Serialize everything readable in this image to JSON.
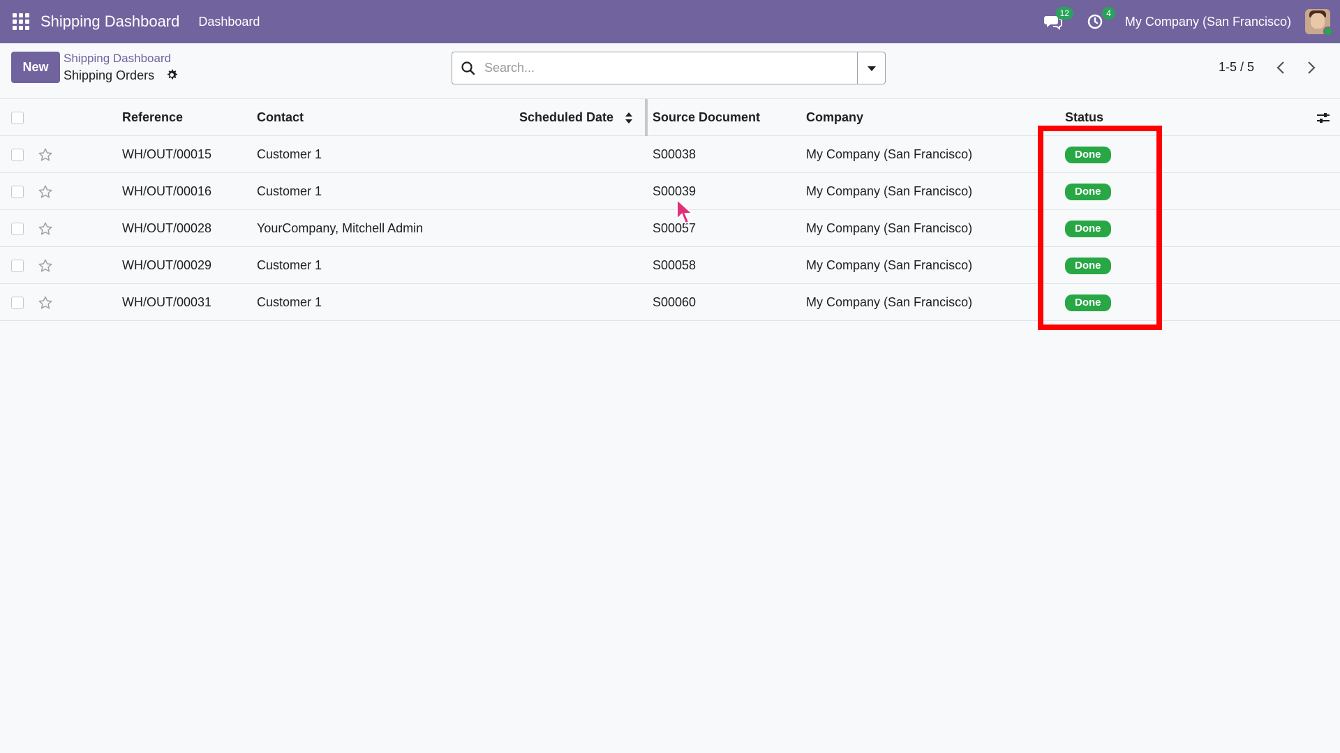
{
  "navbar": {
    "app_title": "Shipping Dashboard",
    "menu_item": "Dashboard",
    "messages_count": "12",
    "activities_count": "4",
    "company": "My Company (San Francisco)"
  },
  "control_panel": {
    "new_label": "New",
    "breadcrumb_parent": "Shipping Dashboard",
    "breadcrumb_current": "Shipping Orders",
    "search_placeholder": "Search...",
    "pager": "1-5 / 5"
  },
  "table": {
    "columns": {
      "reference": "Reference",
      "contact": "Contact",
      "scheduled_date": "Scheduled Date",
      "source_document": "Source Document",
      "company": "Company",
      "status": "Status"
    },
    "rows": [
      {
        "reference": "WH/OUT/00015",
        "contact": "Customer 1",
        "scheduled_date": "",
        "source_document": "S00038",
        "company": "My Company (San Francisco)",
        "status": "Done"
      },
      {
        "reference": "WH/OUT/00016",
        "contact": "Customer 1",
        "scheduled_date": "",
        "source_document": "S00039",
        "company": "My Company (San Francisco)",
        "status": "Done"
      },
      {
        "reference": "WH/OUT/00028",
        "contact": "YourCompany, Mitchell Admin",
        "scheduled_date": "",
        "source_document": "S00057",
        "company": "My Company (San Francisco)",
        "status": "Done"
      },
      {
        "reference": "WH/OUT/00029",
        "contact": "Customer 1",
        "scheduled_date": "",
        "source_document": "S00058",
        "company": "My Company (San Francisco)",
        "status": "Done"
      },
      {
        "reference": "WH/OUT/00031",
        "contact": "Customer 1",
        "scheduled_date": "",
        "source_document": "S00060",
        "company": "My Company (San Francisco)",
        "status": "Done"
      }
    ]
  },
  "colors": {
    "brand": "#71639e",
    "done": "#28a745",
    "highlight": "#ff0000",
    "cursor": "#e0307a"
  },
  "icons": {
    "apps": "apps-grid-icon",
    "messages": "chat-icon",
    "activities": "clock-icon",
    "settings": "gear-icon",
    "search": "search-icon",
    "dropdown": "caret-down-icon",
    "prev": "chevron-left-icon",
    "next": "chevron-right-icon",
    "favorite": "star-icon",
    "sort": "sort-icon",
    "optional_columns": "sliders-icon"
  }
}
